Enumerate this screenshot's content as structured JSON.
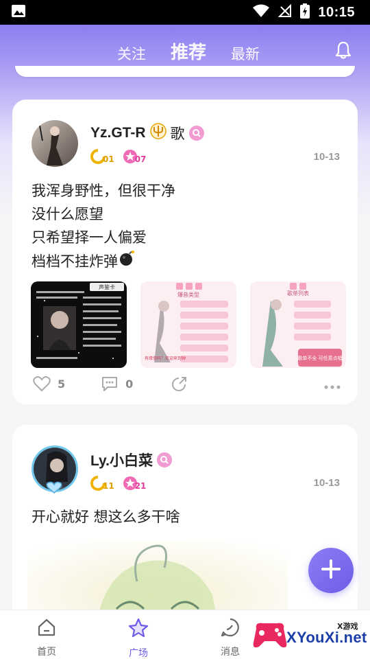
{
  "status_bar": {
    "time": "10:15"
  },
  "header": {
    "tabs": [
      {
        "label": "关注",
        "active": false
      },
      {
        "label": "推荐",
        "active": true
      },
      {
        "label": "最新",
        "active": false
      }
    ]
  },
  "posts": [
    {
      "user": "Yz.GT-R",
      "user_suffix": "歌",
      "badge_gold": "01",
      "badge_pink": "07",
      "date": "10-13",
      "lines": [
        "我浑身野性，但很干净",
        "没什么愿望",
        "只希望择一人偏爱",
        "档档不挂炸弹"
      ],
      "thumbs": [
        {
          "caption": "声鉴卡"
        },
        {
          "caption": "爆音类型",
          "sub": "有缘你吗？欢迎来到钟"
        },
        {
          "caption": "歌单列表",
          "sub": "歌单不全 可任意点唱"
        }
      ],
      "likes": "5",
      "comments": "0"
    },
    {
      "user": "Ly.小白菜",
      "badge_gold": "11",
      "badge_pink": "21",
      "date": "10-13",
      "lines": [
        "开心就好 想这么多干啥"
      ]
    }
  ],
  "bottom_nav": [
    {
      "label": "首页",
      "icon": "home-icon"
    },
    {
      "label": "广场",
      "icon": "star-icon",
      "active": true
    },
    {
      "label": "消息",
      "icon": "message-icon"
    }
  ],
  "watermark": {
    "text": "XYouXi.net",
    "top": "X游戏"
  },
  "colors": {
    "accent": "#6c5ce7",
    "gold": "#e0a000",
    "pink": "#e03c9a"
  }
}
